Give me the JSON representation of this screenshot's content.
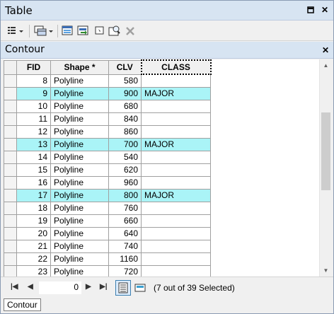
{
  "window": {
    "title": "Table"
  },
  "table_title": "Contour",
  "columns": [
    "FID",
    "Shape *",
    "CLV",
    "CLASS"
  ],
  "rows": [
    {
      "fid": "8",
      "shape": "Polyline",
      "clv": "580",
      "cls": "",
      "selected": false
    },
    {
      "fid": "9",
      "shape": "Polyline",
      "clv": "900",
      "cls": "MAJOR",
      "selected": true
    },
    {
      "fid": "10",
      "shape": "Polyline",
      "clv": "680",
      "cls": "",
      "selected": false
    },
    {
      "fid": "11",
      "shape": "Polyline",
      "clv": "840",
      "cls": "",
      "selected": false
    },
    {
      "fid": "12",
      "shape": "Polyline",
      "clv": "860",
      "cls": "",
      "selected": false
    },
    {
      "fid": "13",
      "shape": "Polyline",
      "clv": "700",
      "cls": "MAJOR",
      "selected": true
    },
    {
      "fid": "14",
      "shape": "Polyline",
      "clv": "540",
      "cls": "",
      "selected": false
    },
    {
      "fid": "15",
      "shape": "Polyline",
      "clv": "620",
      "cls": "",
      "selected": false
    },
    {
      "fid": "16",
      "shape": "Polyline",
      "clv": "960",
      "cls": "",
      "selected": false
    },
    {
      "fid": "17",
      "shape": "Polyline",
      "clv": "800",
      "cls": "MAJOR",
      "selected": true
    },
    {
      "fid": "18",
      "shape": "Polyline",
      "clv": "760",
      "cls": "",
      "selected": false
    },
    {
      "fid": "19",
      "shape": "Polyline",
      "clv": "660",
      "cls": "",
      "selected": false
    },
    {
      "fid": "20",
      "shape": "Polyline",
      "clv": "640",
      "cls": "",
      "selected": false
    },
    {
      "fid": "21",
      "shape": "Polyline",
      "clv": "740",
      "cls": "",
      "selected": false
    },
    {
      "fid": "22",
      "shape": "Polyline",
      "clv": "1160",
      "cls": "",
      "selected": false
    },
    {
      "fid": "23",
      "shape": "Polyline",
      "clv": "720",
      "cls": "",
      "selected": false
    }
  ],
  "navigation": {
    "current_record": "0",
    "status": "(7 out of 39 Selected)"
  },
  "tabs": [
    "Contour"
  ],
  "colors": {
    "selected_row": "#aaf4f7",
    "titlebar": "#d7e4f2"
  },
  "icons": {
    "title": [
      "pin-icon",
      "close-icon"
    ],
    "toolbar": [
      "table-options-icon",
      "related-tables-icon",
      "select-by-attributes-icon",
      "switch-selection-icon",
      "clear-selection-icon",
      "zoom-to-selected-icon",
      "delete-selected-icon"
    ]
  }
}
